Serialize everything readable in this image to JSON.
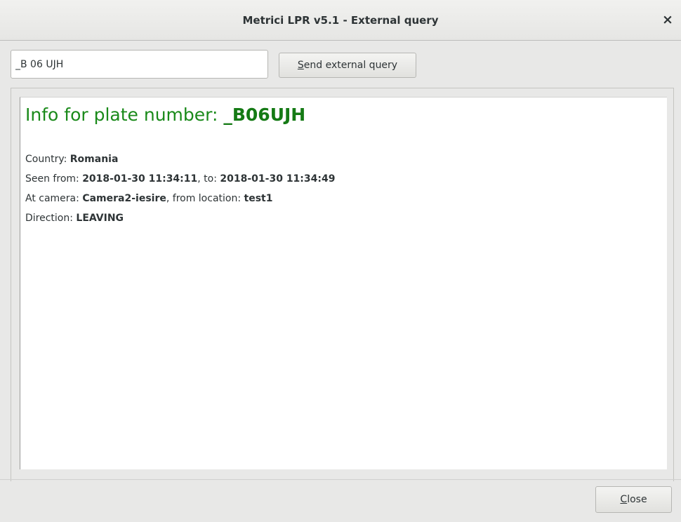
{
  "window": {
    "title": "Metrici LPR v5.1 - External query",
    "close_glyph": "×"
  },
  "query": {
    "value": "_B 06 UJH",
    "send_button_mnemonic": "S",
    "send_button_rest": "end external query"
  },
  "result": {
    "heading_prefix": "Info for plate number: ",
    "plate_number": "_B06UJH",
    "country_label": "Country: ",
    "country_value": "Romania",
    "seen_from_label": "Seen from: ",
    "seen_from_value": "2018-01-30 11:34:11",
    "seen_to_label": ", to: ",
    "seen_to_value": "2018-01-30 11:34:49",
    "camera_label": "At camera: ",
    "camera_value": "Camera2-iesire",
    "location_label": ", from location: ",
    "location_value": "test1",
    "direction_label": "Direction: ",
    "direction_value": "LEAVING"
  },
  "footer": {
    "close_button_mnemonic": "C",
    "close_button_rest": "lose"
  },
  "colors": {
    "heading_green": "#1a8a1a",
    "window_bg": "#e8e8e7",
    "text": "#2e3436"
  }
}
